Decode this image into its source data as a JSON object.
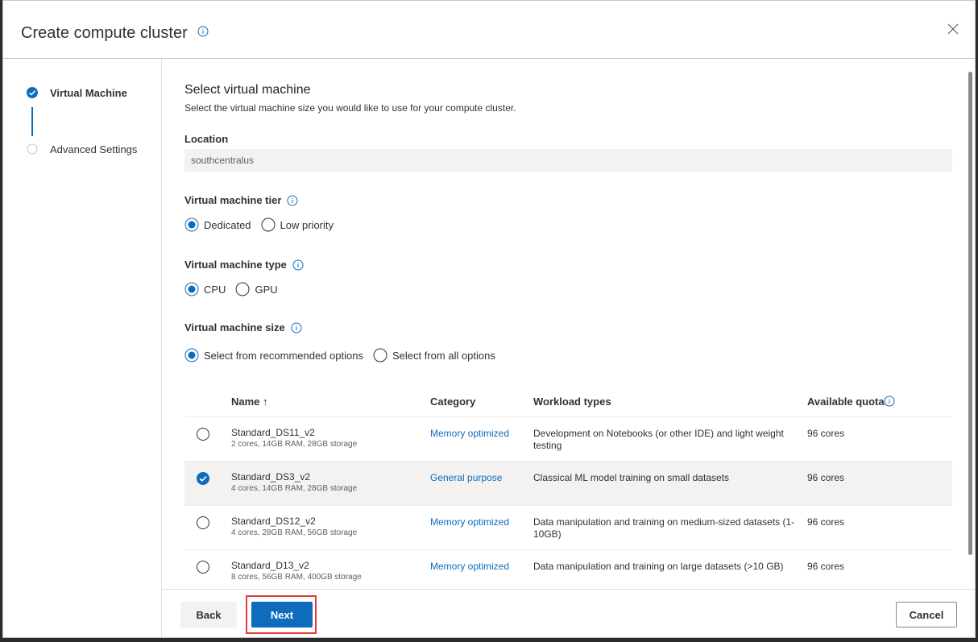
{
  "dialog": {
    "title": "Create compute cluster"
  },
  "sidebar": {
    "steps": [
      {
        "label": "Virtual Machine",
        "state": "current"
      },
      {
        "label": "Advanced Settings",
        "state": "pending"
      }
    ]
  },
  "main": {
    "section_title": "Select virtual machine",
    "section_desc": "Select the virtual machine size you would like to use for your compute cluster.",
    "location": {
      "label": "Location",
      "value": "southcentralus"
    },
    "tier": {
      "label": "Virtual machine tier",
      "options": [
        "Dedicated",
        "Low priority"
      ],
      "selected": "Dedicated"
    },
    "type": {
      "label": "Virtual machine type",
      "options": [
        "CPU",
        "GPU"
      ],
      "selected": "CPU"
    },
    "size": {
      "label": "Virtual machine size",
      "options": [
        "Select from recommended options",
        "Select from all options"
      ],
      "selected": "Select from recommended options"
    },
    "table": {
      "headers": {
        "name": "Name ↑",
        "category": "Category",
        "workload": "Workload types",
        "quota": "Available quota"
      },
      "rows": [
        {
          "name": "Standard_DS11_v2",
          "spec": "2 cores, 14GB RAM, 28GB storage",
          "category": "Memory optimized",
          "workload": "Development on Notebooks (or other IDE) and light weight testing",
          "quota": "96 cores",
          "selected": false
        },
        {
          "name": "Standard_DS3_v2",
          "spec": "4 cores, 14GB RAM, 28GB storage",
          "category": "General purpose",
          "workload": "Classical ML model training on small datasets",
          "quota": "96 cores",
          "selected": true
        },
        {
          "name": "Standard_DS12_v2",
          "spec": "4 cores, 28GB RAM, 56GB storage",
          "category": "Memory optimized",
          "workload": "Data manipulation and training on medium-sized datasets (1-10GB)",
          "quota": "96 cores",
          "selected": false
        },
        {
          "name": "Standard_D13_v2",
          "spec": "8 cores, 56GB RAM, 400GB storage",
          "category": "Memory optimized",
          "workload": "Data manipulation and training on large datasets (>10 GB)",
          "quota": "96 cores",
          "selected": false
        }
      ]
    }
  },
  "footer": {
    "back_label": "Back",
    "next_label": "Next",
    "cancel_label": "Cancel"
  },
  "colors": {
    "accent": "#0f6cbd",
    "highlight": "#e03a3e"
  }
}
